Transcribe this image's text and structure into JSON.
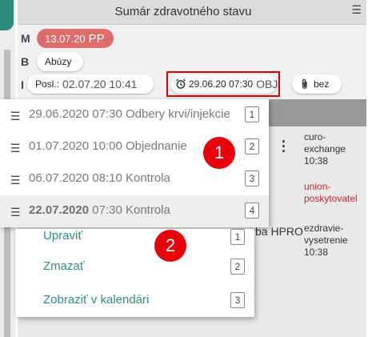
{
  "panel": {
    "title": "Sumár zdravotného stavu"
  },
  "rows": {
    "m_letter": "M",
    "b_letter": "B",
    "i_letter": "I",
    "m_pill_date": "13.07.20",
    "m_pill_code": "PP",
    "b_pill_label": "Abúzy",
    "posl_prefix": "Posl.:",
    "posl_value": "02.07.20 10:41",
    "obj_time": "29.06.20 07:30",
    "obj_label": "OBJ",
    "attach_label": "bez"
  },
  "right_column": {
    "entry1_line1": "curo-",
    "entry1_line2": "exchange",
    "entry1_time": "10:38",
    "entry2_line1": "union-",
    "entry2_line2": "poskytovatel",
    "entry3_line1": "ezdravie-",
    "entry3_line2": "vysetrenie",
    "entry3_time": "10:38",
    "hpro_text": "vba HPRO"
  },
  "dropdown": {
    "items": [
      {
        "date": "29.06.2020",
        "time": "07:30",
        "label": "Odbery krvi/injekcie",
        "number": "1"
      },
      {
        "date": "01.07.2020",
        "time": "10:00",
        "label": "Objednanie",
        "number": "2"
      },
      {
        "date": "06.07.2020",
        "time": "08:10",
        "label": "Kontrola",
        "number": "3"
      },
      {
        "date": "22.07.2020",
        "time": "07:30",
        "label": "Kontrola",
        "number": "4"
      }
    ]
  },
  "submenu": {
    "items": [
      {
        "label": "Upraviť",
        "number": "1"
      },
      {
        "label": "Zmazať",
        "number": "2"
      },
      {
        "label": "Zobraziť v kalendári",
        "number": "3"
      }
    ]
  },
  "callouts": {
    "one": "1",
    "two": "2"
  },
  "colors": {
    "accent_teal": "#2e8a79",
    "pill_red": "#e06b6b",
    "callout_red": "#e8000b",
    "link_teal": "#2f8f7e"
  },
  "icons": {
    "hamburger": "hamburger-icon",
    "alarm": "alarm-clock-icon",
    "attachment": "paperclip-icon",
    "more": "vertical-dots-icon"
  }
}
